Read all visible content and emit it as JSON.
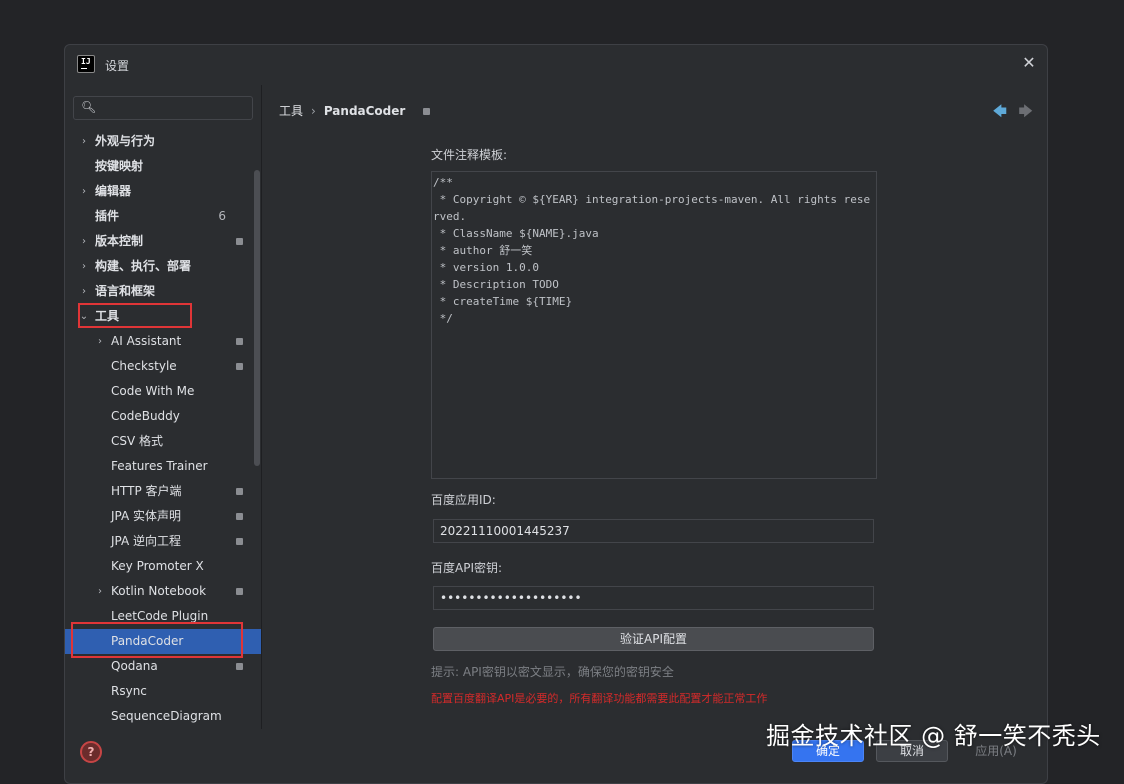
{
  "window": {
    "title": "设置",
    "app_icon_text": "IJ"
  },
  "search": {
    "placeholder": ""
  },
  "sidebar": {
    "items": [
      {
        "label": "外观与行为",
        "arrow": "›",
        "level": 0
      },
      {
        "label": "按键映射",
        "arrow": "",
        "level": 0
      },
      {
        "label": "编辑器",
        "arrow": "›",
        "level": 0
      },
      {
        "label": "插件",
        "arrow": "",
        "level": 0,
        "badge": "6"
      },
      {
        "label": "版本控制",
        "arrow": "›",
        "level": 0,
        "square": true
      },
      {
        "label": "构建、执行、部署",
        "arrow": "›",
        "level": 0
      },
      {
        "label": "语言和框架",
        "arrow": "›",
        "level": 0
      },
      {
        "label": "工具",
        "arrow": "⌄",
        "level": 0
      },
      {
        "label": "AI Assistant",
        "arrow": "›",
        "level": 1,
        "square": true
      },
      {
        "label": "Checkstyle",
        "arrow": "",
        "level": 1,
        "square": true
      },
      {
        "label": "Code With Me",
        "arrow": "",
        "level": 1
      },
      {
        "label": "CodeBuddy",
        "arrow": "",
        "level": 1
      },
      {
        "label": "CSV 格式",
        "arrow": "",
        "level": 1
      },
      {
        "label": "Features Trainer",
        "arrow": "",
        "level": 1
      },
      {
        "label": "HTTP 客户端",
        "arrow": "",
        "level": 1,
        "square": true
      },
      {
        "label": "JPA 实体声明",
        "arrow": "",
        "level": 1,
        "square": true
      },
      {
        "label": "JPA 逆向工程",
        "arrow": "",
        "level": 1,
        "square": true
      },
      {
        "label": "Key Promoter X",
        "arrow": "",
        "level": 1
      },
      {
        "label": "Kotlin Notebook",
        "arrow": "›",
        "level": 1,
        "square": true
      },
      {
        "label": "LeetCode Plugin",
        "arrow": "",
        "level": 1
      },
      {
        "label": "PandaCoder",
        "arrow": "",
        "level": 1,
        "selected": true
      },
      {
        "label": "Qodana",
        "arrow": "",
        "level": 1,
        "square": true
      },
      {
        "label": "Rsync",
        "arrow": "",
        "level": 1
      },
      {
        "label": "SequenceDiagram",
        "arrow": "",
        "level": 1
      }
    ]
  },
  "breadcrumb": {
    "parent": "工具",
    "sep": "›",
    "current": "PandaCoder"
  },
  "nav": {
    "back": "🡄",
    "forward": "🡆"
  },
  "form": {
    "template_label": "文件注释模板:",
    "template_value": "/**\n * Copyright © ${YEAR} integration-projects-maven. All rights reserved.\n * ClassName ${NAME}.java\n * author 舒一笑\n * version 1.0.0\n * Description TODO\n * createTime ${TIME}\n */",
    "app_id_label": "百度应用ID:",
    "app_id_value": "20221110001445237",
    "api_key_label": "百度API密钥:",
    "api_key_value": "••••••••••••••••••••",
    "verify_button": "验证API配置",
    "hint": "提示: API密钥以密文显示，确保您的密钥安全",
    "warning": "配置百度翻译API是必要的，所有翻译功能都需要此配置才能正常工作"
  },
  "footer": {
    "ok": "确定",
    "cancel": "取消",
    "apply": "应用(A)",
    "help": "?"
  },
  "watermark": "掘金技术社区 @ 舒一笑不秃头",
  "colors": {
    "accent": "#3574f0",
    "selected": "#2f5fb1",
    "highlight": "#e03537",
    "warning": "#d42a2a"
  }
}
